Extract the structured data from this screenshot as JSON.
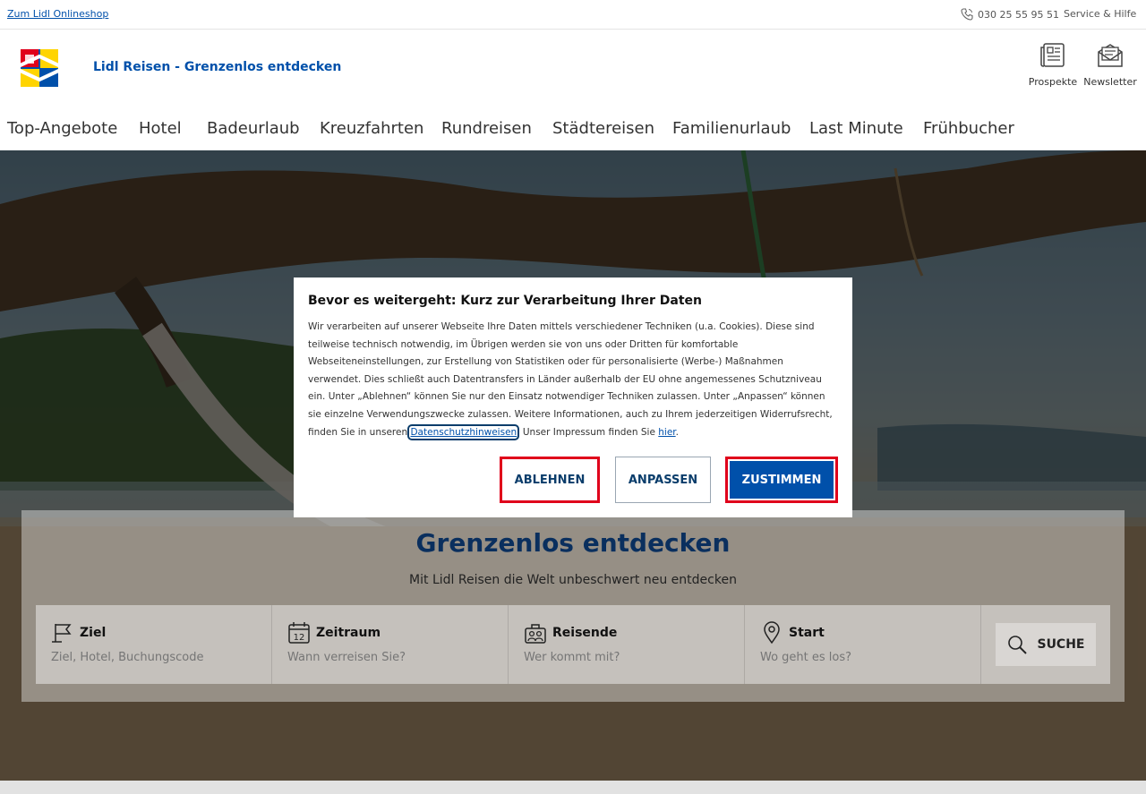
{
  "topbar": {
    "shop_link": "Zum Lidl Onlineshop",
    "phone": "030 25 55 95 51",
    "service": "Service & Hilfe"
  },
  "header": {
    "brand_title": "Lidl Reisen - Grenzenlos entdecken",
    "icons": [
      {
        "name": "brochure-icon",
        "label": "Prospekte"
      },
      {
        "name": "newsletter-icon",
        "label": "Newsletter"
      }
    ]
  },
  "nav": {
    "items": [
      "Top-Angebote",
      "Hotel",
      "Badeurlaub",
      "Kreuzfahrten",
      "Rundreisen",
      "Städtereisen",
      "Familienurlaub",
      "Last Minute",
      "Frühbucher"
    ]
  },
  "search": {
    "title": "Grenzenlos entdecken",
    "subtitle": "Mit Lidl Reisen die Welt unbeschwert neu entdecken",
    "fields": [
      {
        "label": "Ziel",
        "placeholder": "Ziel, Hotel, Buchungscode",
        "icon": "flag-icon"
      },
      {
        "label": "Zeitraum",
        "placeholder": "Wann verreisen Sie?",
        "icon": "calendar-icon"
      },
      {
        "label": "Reisende",
        "placeholder": "Wer kommt mit?",
        "icon": "travellers-icon"
      },
      {
        "label": "Start",
        "placeholder": "Wo geht es los?",
        "icon": "location-pin-icon"
      }
    ],
    "calendar_day": "12",
    "button_label": "SUCHE"
  },
  "consent": {
    "title": "Bevor es weitergeht: Kurz zur Verarbeitung Ihrer Daten",
    "text_main": "Wir verarbeiten auf unserer Webseite Ihre Daten mittels verschiedener Techniken (u.a. Cookies). Diese sind teilweise technisch notwendig, im Übrigen werden sie von uns oder Dritten für komfortable Webseiteneinstellungen, zur Erstellung von Statistiken oder für personalisierte (Werbe-) Maßnahmen verwendet. Dies schließt auch Datentransfers in Länder außerhalb der EU ohne angemessenes Schutzniveau ein. Unter „Ablehnen“ können Sie nur den Einsatz notwendiger Techniken zulassen. Unter „Anpassen“ können sie einzelne Verwendungszwecke zulassen. Weitere Informationen, auch zu Ihrem jederzeitigen Widerrufsrecht, finden Sie in unseren",
    "privacy_link": "Datenschutzhinweisen",
    "text_imprint": ". Unser Impressum finden Sie",
    "imprint_link": "hier",
    "text_end": ".",
    "decline": "ABLEHNEN",
    "customize": "ANPASSEN",
    "accept": "ZUSTIMMEN"
  },
  "colors": {
    "brand_blue": "#0050aa",
    "dark_blue": "#0a2f5e",
    "highlight_red": "#e0001b"
  }
}
